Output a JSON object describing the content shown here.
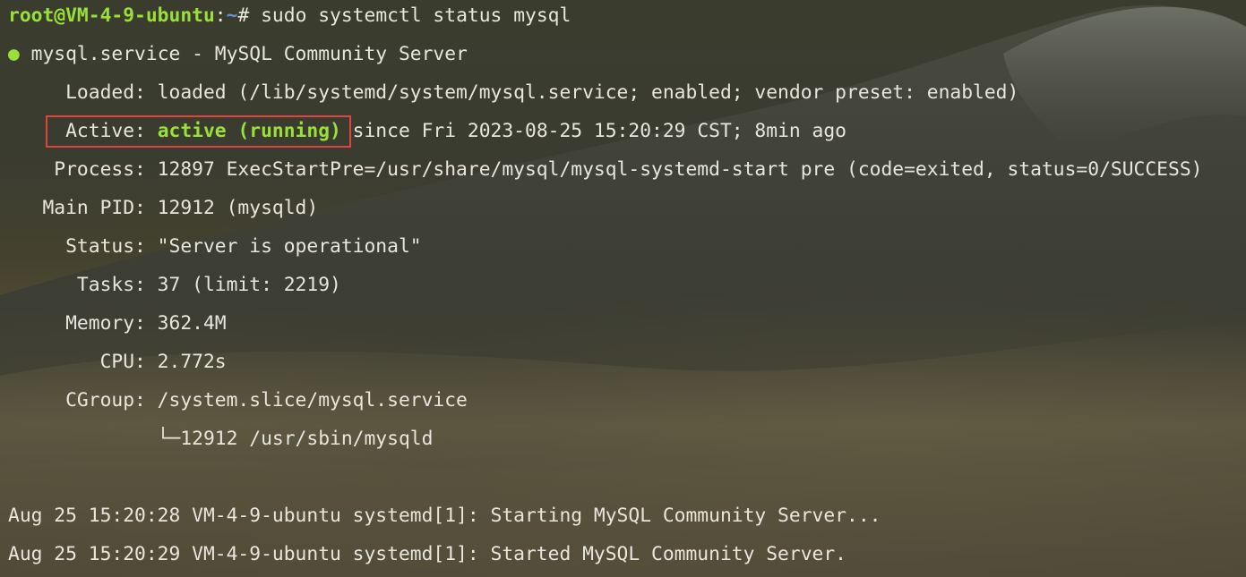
{
  "prompt": {
    "user_host": "root@VM-4-9-ubuntu",
    "separator": ":",
    "path": "~",
    "symbol": "# ",
    "command": "sudo systemctl status mysql"
  },
  "service": {
    "dot": "●",
    "name_line": " mysql.service - MySQL Community Server"
  },
  "status": {
    "loaded": "     Loaded: loaded (/lib/systemd/system/mysql.service; enabled; vendor preset: enabled)",
    "active_label": "     Active: ",
    "active_value": "active (running)",
    "active_rest": " since Fri 2023-08-25 15:20:29 CST; 8min ago",
    "process": "    Process: 12897 ExecStartPre=/usr/share/mysql/mysql-systemd-start pre (code=exited, status=0/SUCCESS)",
    "main_pid": "   Main PID: 12912 (mysqld)",
    "status_line": "     Status: \"Server is operational\"",
    "tasks": "      Tasks: 37 (limit: 2219)",
    "memory": "     Memory: 362.4M",
    "cpu": "        CPU: 2.772s",
    "cgroup": "     CGroup: /system.slice/mysql.service",
    "cgroup_child": "             └─12912 /usr/sbin/mysqld"
  },
  "logs": [
    "Aug 25 15:20:28 VM-4-9-ubuntu systemd[1]: Starting MySQL Community Server...",
    "Aug 25 15:20:29 VM-4-9-ubuntu systemd[1]: Started MySQL Community Server."
  ]
}
